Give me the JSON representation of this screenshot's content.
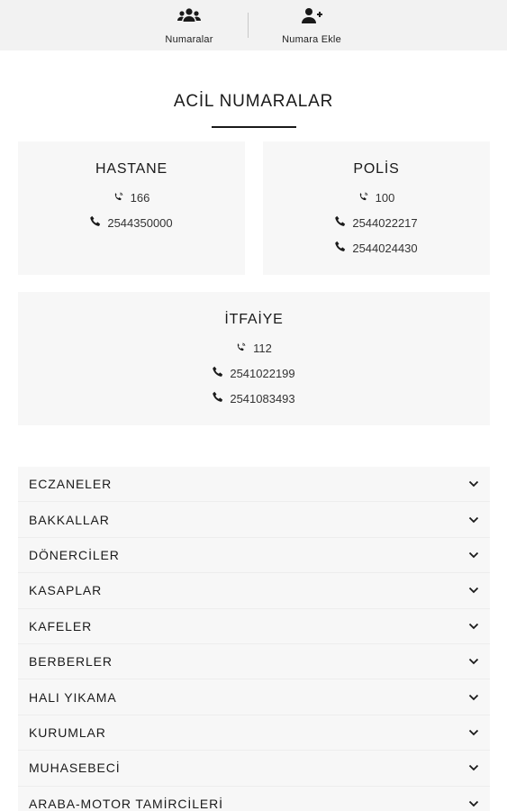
{
  "nav": {
    "tabs": [
      {
        "label": "Numaralar",
        "icon": "users-icon"
      },
      {
        "label": "Numara Ekle",
        "icon": "user-plus-icon"
      }
    ]
  },
  "section": {
    "title": "ACİL NUMARALAR"
  },
  "emergency": [
    {
      "name": "HASTANE",
      "short": "166",
      "phones": [
        "2544350000"
      ]
    },
    {
      "name": "POLİS",
      "short": "100",
      "phones": [
        "2544022217",
        "2544024430"
      ]
    },
    {
      "name": "İTFAİYE",
      "short": "112",
      "phones": [
        "2541022199",
        "2541083493"
      ]
    }
  ],
  "categories": [
    "ECZANELER",
    "BAKKALLAR",
    "DÖNERCİLER",
    "KASAPLAR",
    "KAFELER",
    "BERBERLER",
    "HALI YIKAMA",
    "KURUMLAR",
    "MUHASEBECİ",
    "ARABA-MOTOR TAMİRCİLERİ"
  ],
  "colors": {
    "topbar": "#f2f2f2",
    "card": "#f7f7f7",
    "text": "#1a1a1a"
  }
}
